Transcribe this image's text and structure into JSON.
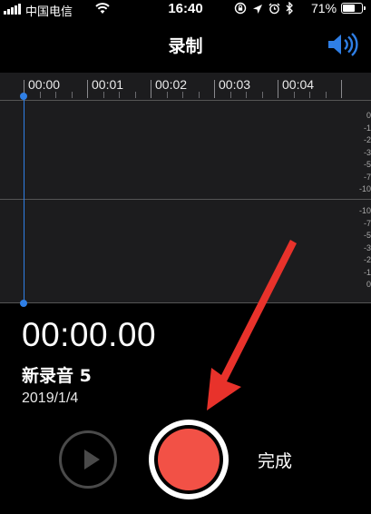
{
  "status_bar": {
    "carrier": "中国电信",
    "time": "16:40",
    "battery_percent": "71%",
    "battery_level": 0.71
  },
  "nav": {
    "title": "录制"
  },
  "timeline": {
    "labels": [
      "00:00",
      "00:01",
      "00:02",
      "00:03",
      "00:04"
    ]
  },
  "db_scale": {
    "upper": [
      "0",
      "-1",
      "-2",
      "-3",
      "-5",
      "-7",
      "-10"
    ],
    "lower": [
      "-10",
      "-7",
      "-5",
      "-3",
      "-2",
      "-1",
      "0"
    ]
  },
  "recording": {
    "elapsed": "00:00.00",
    "name": "新录音 5",
    "date": "2019/1/4"
  },
  "controls": {
    "done_label": "完成"
  },
  "colors": {
    "accent": "#2f7fe6",
    "record": "#f25146",
    "annotation_arrow": "#e8322b"
  }
}
